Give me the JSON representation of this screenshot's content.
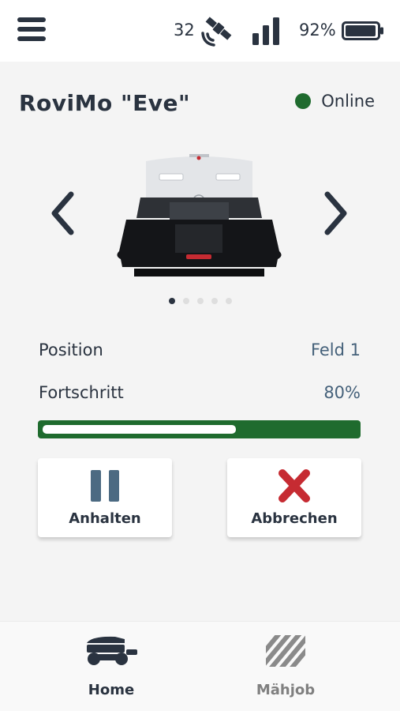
{
  "status_bar": {
    "satellites": "32",
    "battery": "92%",
    "icons": {
      "menu": "hamburger-menu-icon",
      "satellite": "satellite-icon",
      "signal": "signal-bars-icon",
      "battery": "battery-icon"
    }
  },
  "device": {
    "name": "RoviMo \"Eve\"",
    "status": "Online",
    "status_color": "#1f6b2e",
    "carousel": {
      "slides": 5,
      "active_slide": 1
    }
  },
  "details": {
    "position_label": "Position",
    "position_value": "Feld 1",
    "progress_label": "Fortschritt",
    "progress_value": "80%",
    "progress_fraction": 0.8
  },
  "actions": {
    "pause_label": "Anhalten",
    "cancel_label": "Abbrechen"
  },
  "nav": {
    "home_label": "Home",
    "job_label": "Mähjob",
    "active": "home"
  },
  "colors": {
    "primary_text": "#2a3340",
    "accent_green": "#1f6b2e",
    "value_blue": "#45617a",
    "pause_icon": "#4c6a82",
    "cancel_icon": "#c62b32"
  }
}
